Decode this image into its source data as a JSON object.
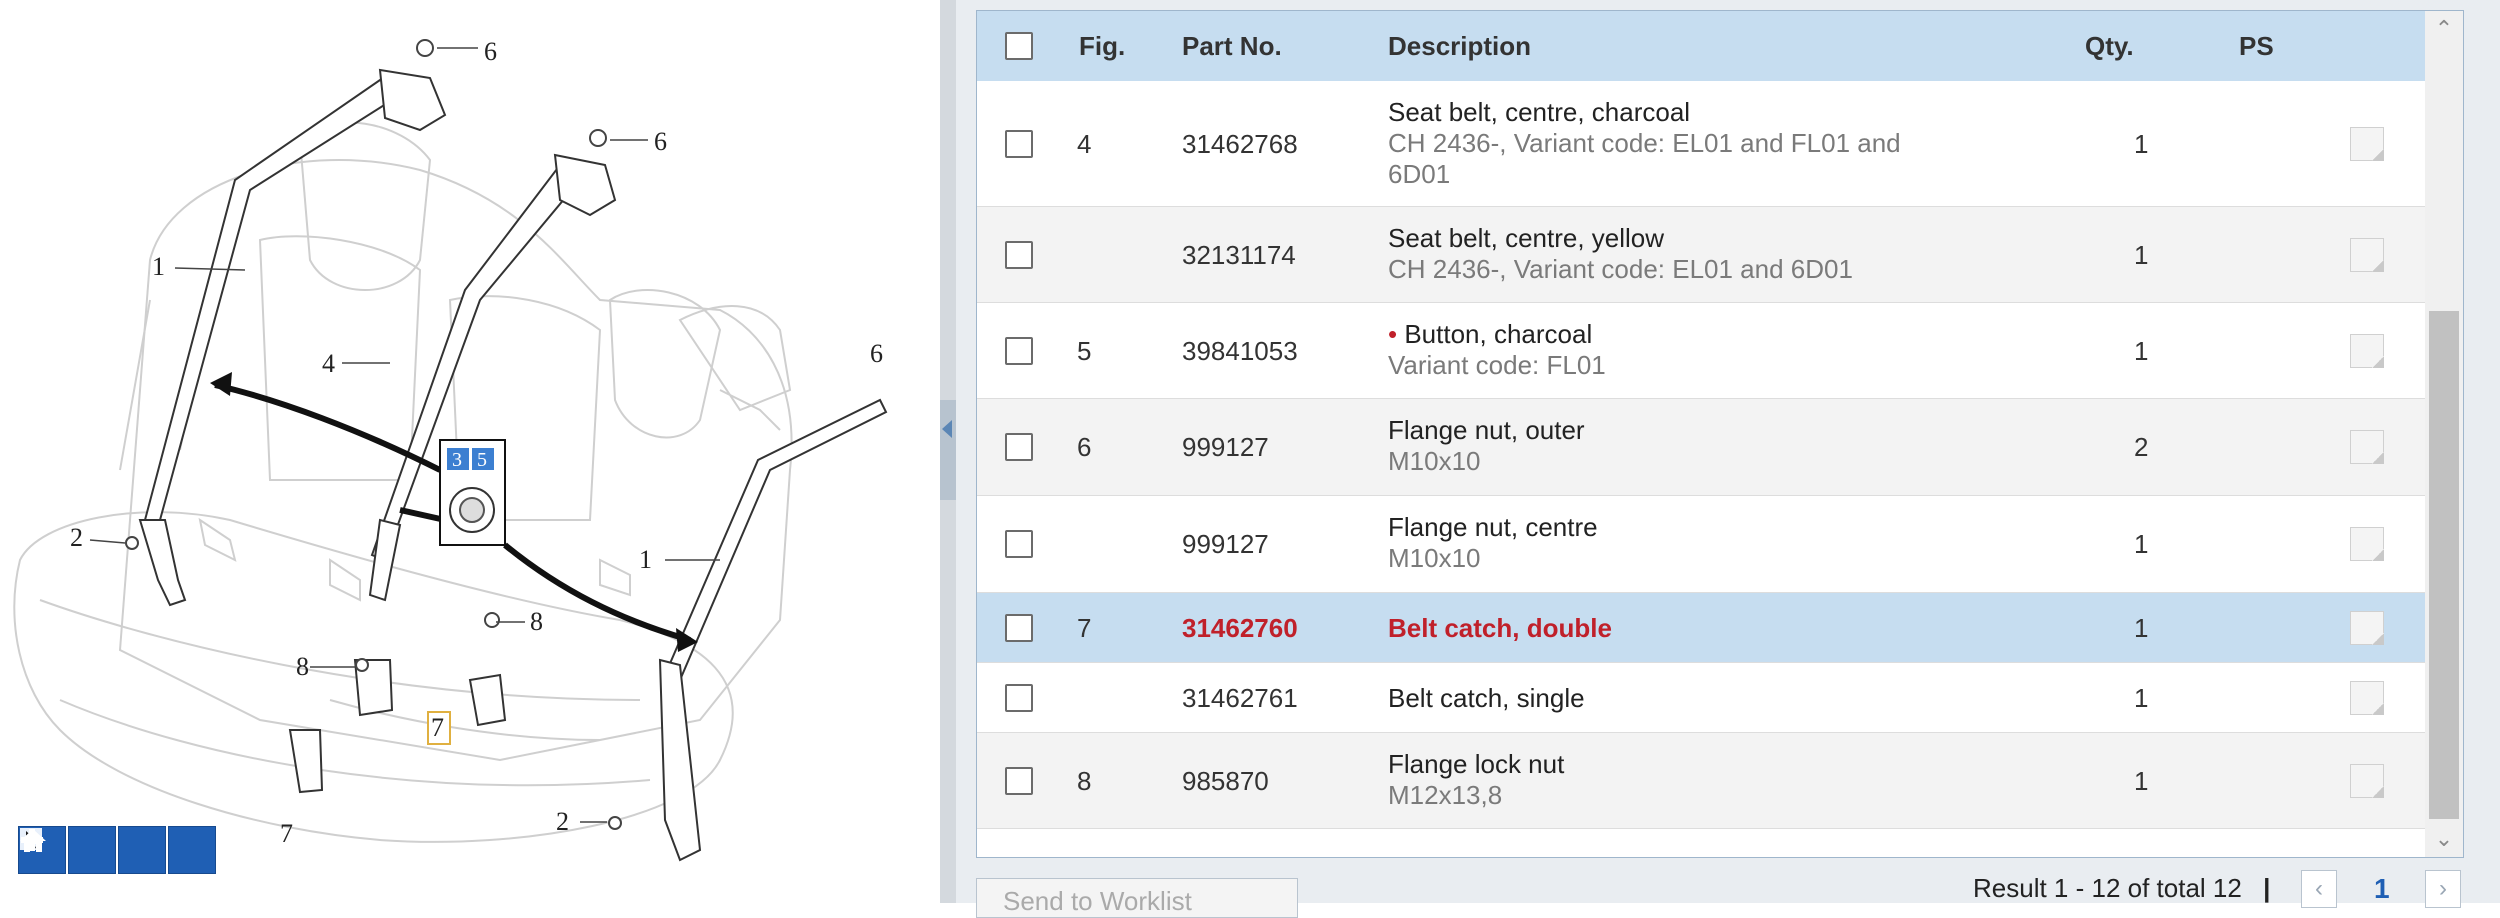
{
  "diagram": {
    "callouts": [
      "6",
      "6",
      "1",
      "4",
      "1",
      "2",
      "8",
      "8",
      "7",
      "7",
      "2",
      "6"
    ],
    "zoom_box_labels": [
      "3",
      "5"
    ],
    "toolbar": {
      "select": "pointer-icon",
      "zoom_in": "plus-icon",
      "zoom_out": "minus-icon",
      "home": "home-icon"
    }
  },
  "table": {
    "headers": {
      "fig": "Fig.",
      "part_no": "Part No.",
      "description": "Description",
      "qty": "Qty.",
      "ps": "PS"
    },
    "rows": [
      {
        "fig": "4",
        "part_no": "31462768",
        "desc": "Seat belt, centre, charcoal",
        "note_line1": "CH 2436-, Variant code: EL01 and FL01 and",
        "note_line2": "6D01",
        "qty": "1"
      },
      {
        "fig": "",
        "part_no": "32131174",
        "desc": "Seat belt, centre, yellow",
        "note_line1": "CH 2436-, Variant code: EL01 and 6D01",
        "qty": "1"
      },
      {
        "fig": "5",
        "part_no": "39841053",
        "bullet": "•",
        "desc": "Button, charcoal",
        "note_line1": "Variant code: FL01",
        "qty": "1"
      },
      {
        "fig": "6",
        "part_no": "999127",
        "desc": "Flange nut, outer",
        "note_line1": "M10x10",
        "qty": "2"
      },
      {
        "fig": "",
        "part_no": "999127",
        "desc": "Flange nut, centre",
        "note_line1": "M10x10",
        "qty": "1"
      },
      {
        "fig": "7",
        "part_no": "31462760",
        "desc": "Belt catch, double",
        "qty": "1",
        "selected": true
      },
      {
        "fig": "",
        "part_no": "31462761",
        "desc": "Belt catch, single",
        "qty": "1"
      },
      {
        "fig": "8",
        "part_no": "985870",
        "desc": "Flange lock nut",
        "note_line1": "M12x13,8",
        "qty": "1"
      }
    ]
  },
  "footer": {
    "worklist_button": "Send to Worklist",
    "result_text": "Result 1 - 12 of total 12",
    "separator": "|",
    "prev": "‹",
    "current_page": "1",
    "next": "›"
  },
  "colors": {
    "header_bg": "#c6ddf0",
    "selected_row_bg": "#c6ddf0",
    "selected_text": "#c0202a",
    "toolbar_blue": "#1f5fb4"
  }
}
